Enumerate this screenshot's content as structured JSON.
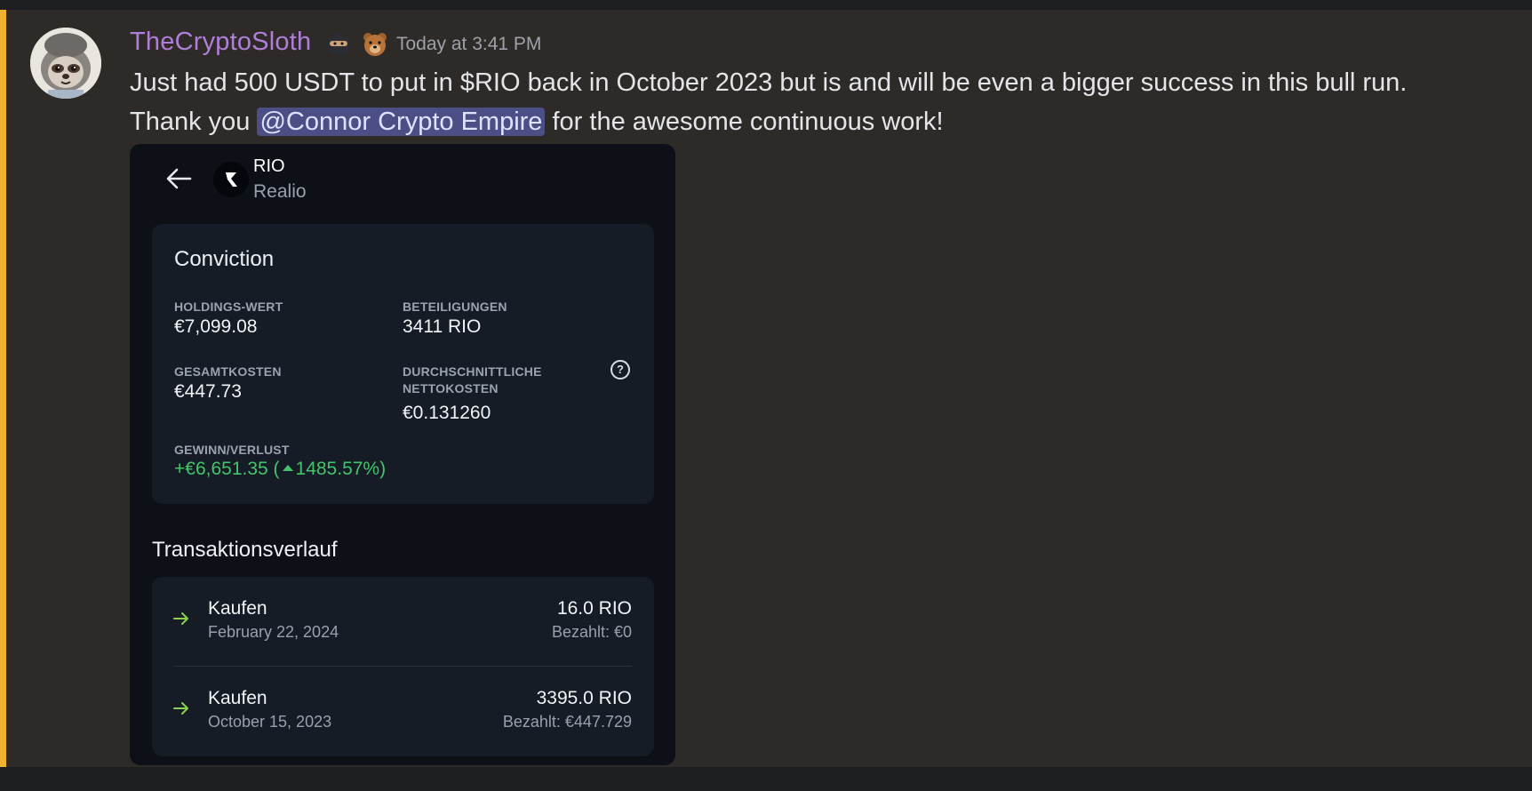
{
  "message": {
    "username": "TheCryptoSloth",
    "badges": [
      "ninja-emoji",
      "bear-emoji"
    ],
    "timestamp": "Today at 3:41 PM",
    "text_before_mention": "Just had 500 USDT to put in $RIO back in October 2023 but is and will be even a bigger success in this bull run. Thank you ",
    "mention": "@Connor Crypto Empire",
    "text_after_mention": " for the awesome continuous work!"
  },
  "screenshot": {
    "coin": {
      "symbol": "RIO",
      "name": "Realio"
    },
    "conviction": {
      "title": "Conviction",
      "holdings_label": "HOLDINGS-WERT",
      "holdings_value": "€7,099.08",
      "stakes_label": "BETEILIGUNGEN",
      "stakes_value": "3411 RIO",
      "total_cost_label": "GESAMTKOSTEN",
      "total_cost_value": "€447.73",
      "avg_cost_label_1": "DURCHSCHNITTLICHE",
      "avg_cost_label_2": "NETTOKOSTEN",
      "avg_cost_value": "€0.131260",
      "help_icon": "?",
      "pnl_label": "GEWINN/VERLUST",
      "pnl_value": "+€6,651.35 (",
      "pnl_percent": "1485.57%)",
      "pnl_color": "#43c46b"
    },
    "transactions": {
      "title": "Transaktionsverlauf",
      "items": [
        {
          "type": "Kaufen",
          "date": "February 22, 2024",
          "amount": "16.0 RIO",
          "paid": "Bezahlt: €0"
        },
        {
          "type": "Kaufen",
          "date": "October 15, 2023",
          "amount": "3395.0 RIO",
          "paid": "Bezahlt: €447.729"
        }
      ]
    }
  },
  "colors": {
    "username": "#b07ed9",
    "mention_bg": "#4b4f86",
    "highlight_bar": "#f0b232",
    "arrow_green": "#8bd14f"
  }
}
